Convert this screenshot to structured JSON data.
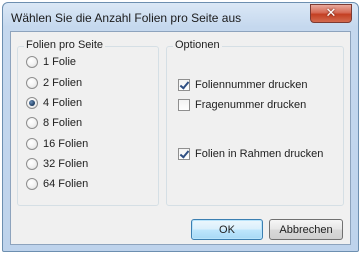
{
  "dialog": {
    "title": "Wählen Sie die Anzahl Folien pro Seite aus",
    "close_glyph": "✕"
  },
  "slides_per_page": {
    "label": "Folien pro Seite",
    "selected": "4 Folien",
    "options": [
      "1 Folie",
      "2 Folien",
      "4 Folien",
      "8 Folien",
      "16 Folien",
      "32 Folien",
      "64 Folien"
    ]
  },
  "options": {
    "label": "Optionen",
    "items": [
      {
        "label": "Foliennummer drucken",
        "checked": true
      },
      {
        "label": "Fragenummer drucken",
        "checked": false
      },
      {
        "label": "Folien in Rahmen drucken",
        "checked": true
      }
    ]
  },
  "buttons": {
    "ok": "OK",
    "cancel": "Abbrechen"
  }
}
